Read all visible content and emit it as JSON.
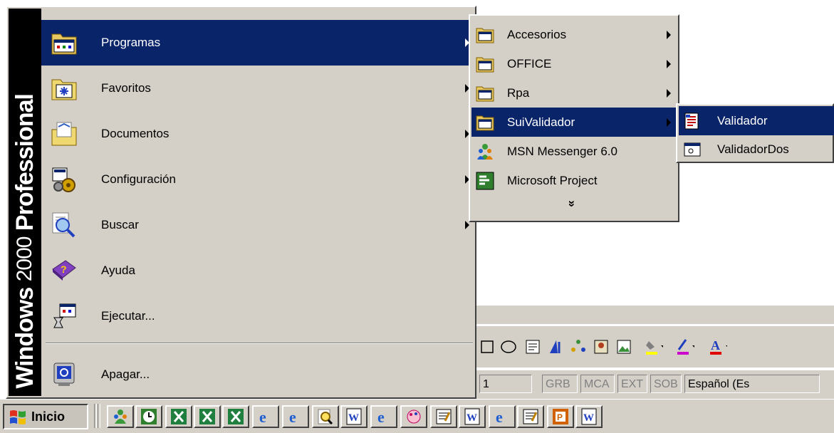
{
  "start_menu": {
    "banner": {
      "brand": "Windows",
      "version": "2000",
      "edition": "Professional"
    },
    "items": [
      {
        "label": "Programas",
        "icon": "programs-folder-icon",
        "has_submenu": true,
        "highlighted": true
      },
      {
        "label": "Favoritos",
        "icon": "favorites-folder-icon",
        "has_submenu": true
      },
      {
        "label": "Documentos",
        "icon": "documents-folder-icon",
        "has_submenu": true
      },
      {
        "label": "Configuración",
        "icon": "settings-icon",
        "has_submenu": true
      },
      {
        "label": "Buscar",
        "icon": "search-icon",
        "has_submenu": true
      },
      {
        "label": "Ayuda",
        "icon": "help-book-icon",
        "has_submenu": false
      },
      {
        "label": "Ejecutar...",
        "icon": "run-icon",
        "has_submenu": false
      },
      {
        "label": "Apagar...",
        "icon": "shutdown-icon",
        "has_submenu": false
      }
    ]
  },
  "programs_submenu": {
    "items": [
      {
        "label": "Accesorios",
        "icon": "program-group-icon",
        "has_submenu": true
      },
      {
        "label": "OFFICE",
        "icon": "program-group-icon",
        "has_submenu": true
      },
      {
        "label": "Rpa",
        "icon": "program-group-icon",
        "has_submenu": true
      },
      {
        "label": "SuiValidador",
        "icon": "program-group-icon",
        "has_submenu": true,
        "highlighted": true
      },
      {
        "label": "MSN Messenger 6.0",
        "icon": "msn-messenger-icon",
        "has_submenu": false
      },
      {
        "label": "Microsoft Project",
        "icon": "ms-project-icon",
        "has_submenu": false
      }
    ],
    "expand_glyph": "»"
  },
  "suivalidador_submenu": {
    "items": [
      {
        "label": "Validador",
        "icon": "validador-app-icon",
        "highlighted": true
      },
      {
        "label": "ValidadorDos",
        "icon": "window-app-icon"
      }
    ]
  },
  "status_bar": {
    "line": "1",
    "indicators": [
      "GRB",
      "MCA",
      "EXT",
      "SOB"
    ],
    "language": "Español (Es"
  },
  "taskbar": {
    "start_label": "Inicio",
    "buttons": [
      "msn-messenger-icon",
      "clock-icon",
      "excel-icon",
      "excel-icon",
      "excel-icon",
      "internet-explorer-icon",
      "internet-explorer-icon",
      "search-icon",
      "word-icon",
      "internet-explorer-icon",
      "paint-icon",
      "wordpad-icon",
      "word-icon",
      "internet-explorer-icon",
      "wordpad-icon",
      "powerpoint-icon",
      "word-icon"
    ]
  },
  "colors": {
    "highlight": "#0a246a",
    "face": "#d4d0c8",
    "banner": "#000000"
  }
}
